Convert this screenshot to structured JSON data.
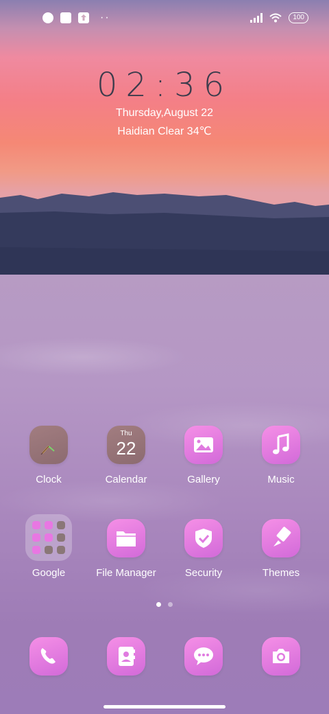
{
  "status": {
    "battery": "100",
    "more_dots": "··"
  },
  "lockclock": {
    "time": "02:36",
    "date": "Thursday,August 22",
    "weather": "Haidian Clear 34℃"
  },
  "apps_row1": [
    {
      "label": "Clock",
      "icon": "clock-icon"
    },
    {
      "label": "Calendar",
      "icon": "calendar-icon",
      "day_short": "Thu",
      "day_num": "22"
    },
    {
      "label": "Gallery",
      "icon": "gallery-icon"
    },
    {
      "label": "Music",
      "icon": "music-icon"
    }
  ],
  "apps_row2": [
    {
      "label": "Google",
      "icon": "google-folder-icon"
    },
    {
      "label": "File Manager",
      "icon": "folder-icon"
    },
    {
      "label": "Security",
      "icon": "shield-icon"
    },
    {
      "label": "Themes",
      "icon": "brush-icon"
    }
  ],
  "dock": [
    {
      "icon": "phone-icon"
    },
    {
      "icon": "contacts-icon"
    },
    {
      "icon": "messages-icon"
    },
    {
      "icon": "camera-icon"
    }
  ],
  "page_indicator": {
    "pages": 2,
    "current": 1
  },
  "colors": {
    "icon_gradient_start": "#f58fe6",
    "icon_gradient_end": "#d26ad9",
    "clock_text": "#3c3c4c"
  }
}
